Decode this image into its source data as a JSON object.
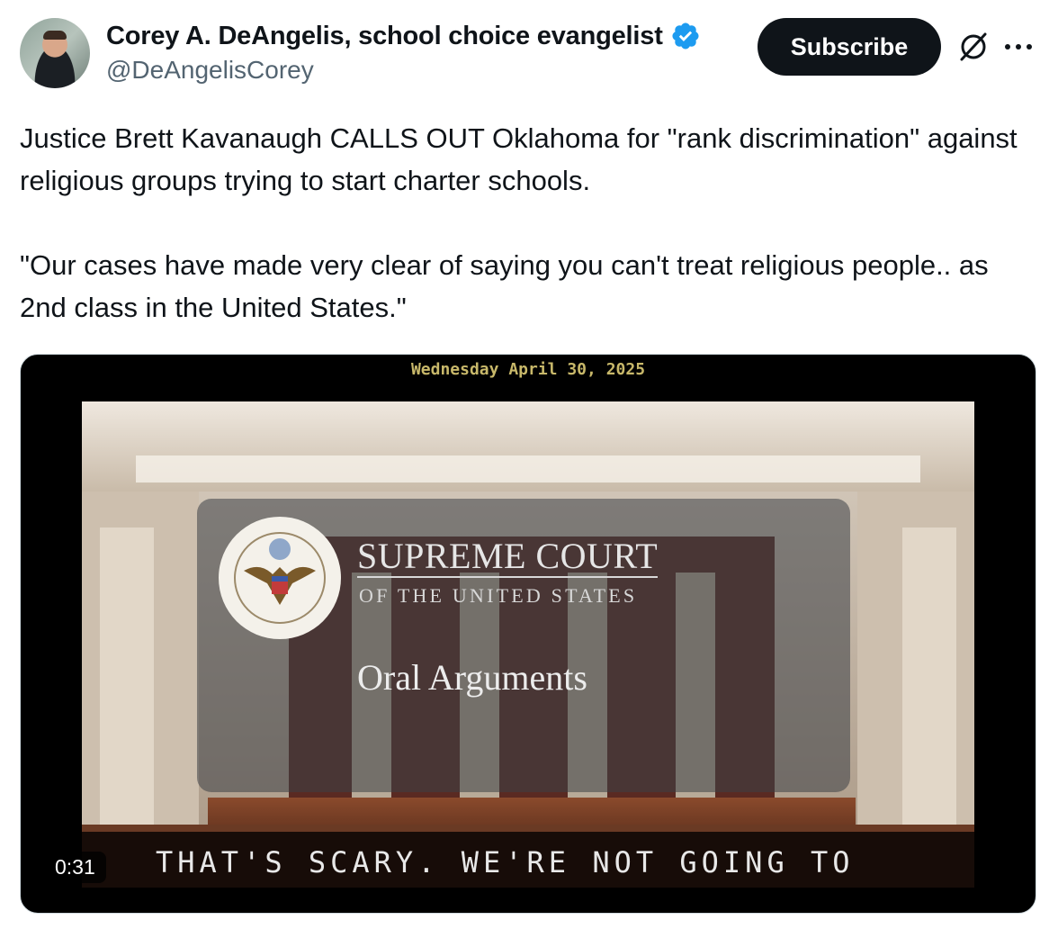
{
  "author": {
    "display_name": "Corey A. DeAngelis, school choice evangelist",
    "handle": "@DeAngelisCorey",
    "verified": true,
    "verified_color": "#1d9bf0"
  },
  "actions": {
    "subscribe_label": "Subscribe",
    "grok_icon": "grok-icon",
    "more_icon": "more-icon"
  },
  "tweet": {
    "text": "Justice Brett Kavanaugh CALLS OUT Oklahoma for \"rank discrimination\" against religious groups trying to start charter schools.\n\n\"Our cases have made very clear of saying you can't treat religious people.. as 2nd class in the United States.\""
  },
  "video": {
    "date_overlay": "Wednesday April 30, 2025",
    "title": "SUPREME COURT",
    "subtitle": "OF THE UNITED STATES",
    "program": "Oral Arguments",
    "caption": "THAT'S SCARY. WE'RE NOT GOING TO",
    "duration": "0:31"
  },
  "colors": {
    "text_primary": "#0f1419",
    "text_secondary": "#536471",
    "button_bg": "#0f1419"
  }
}
